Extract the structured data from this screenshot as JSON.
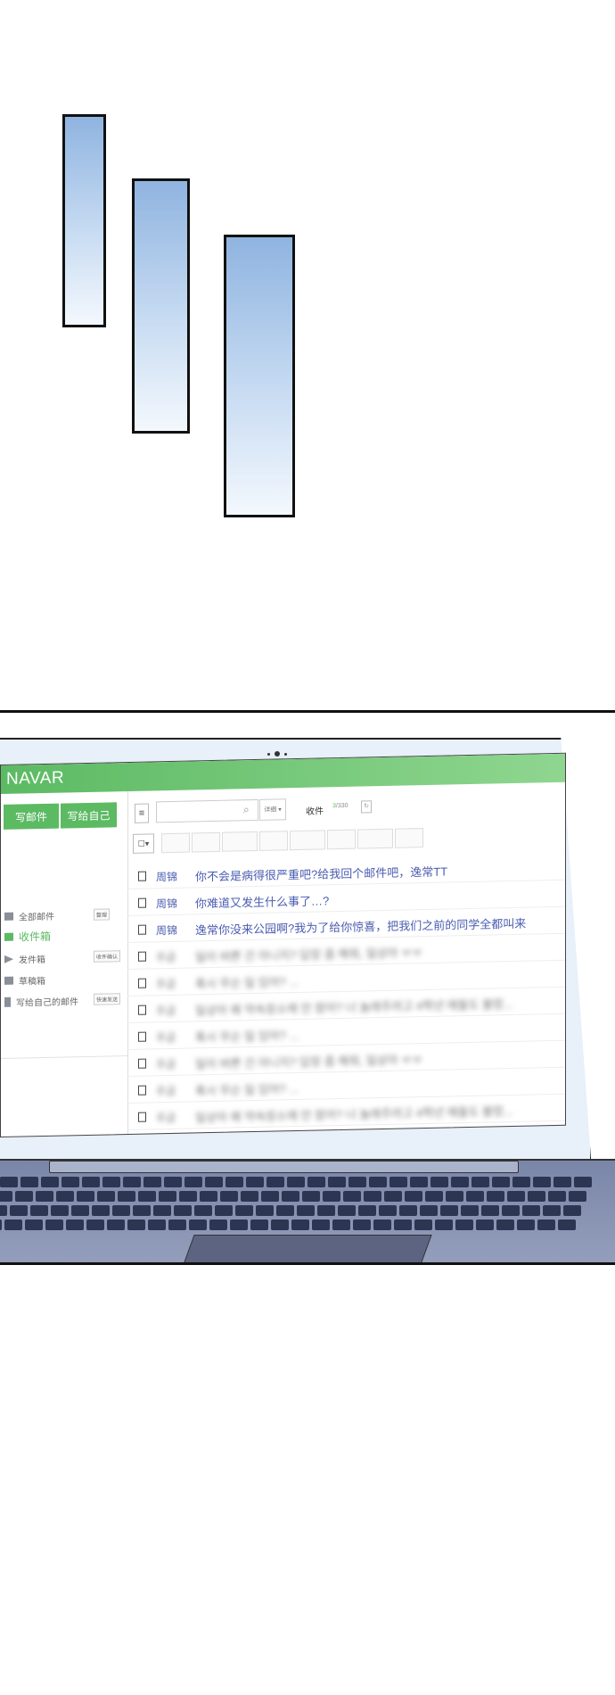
{
  "app": {
    "logo": "NAVAR"
  },
  "sidebar": {
    "compose_label": "写邮件",
    "write_self_label": "写给自己",
    "items": [
      {
        "label": "全部邮件",
        "tag": "整理",
        "icon": "mail-icon"
      },
      {
        "label": "收件箱",
        "tag": "",
        "icon": "inbox-icon"
      },
      {
        "label": "发件箱",
        "tag": "收件确认",
        "icon": "send-icon"
      },
      {
        "label": "草稿箱",
        "tag": "",
        "icon": "folder-icon"
      },
      {
        "label": "写给自己的邮件",
        "tag": "快速发送",
        "icon": "note-icon"
      }
    ]
  },
  "toolbar": {
    "detail_label": "详细 ▾",
    "inbox_label": "收件",
    "unread_count": "3",
    "total_count": "/330"
  },
  "mail_list": [
    {
      "sender": "周锦",
      "subject": "你不会是病得很严重吧?给我回个邮件吧，逸常TT"
    },
    {
      "sender": "周锦",
      "subject": "你难道又发生什么事了…?"
    },
    {
      "sender": "周锦",
      "subject": "逸常你没来公园啊?我为了给你惊喜，把我们之前的同学全都叫来"
    },
    {
      "sender": "주급",
      "subject": "일이 바쁜 건 아니지? 답장 좀 해줘, 일상아 ㅠㅠ"
    },
    {
      "sender": "주급",
      "subject": "혹시 무슨 일 있어? ..."
    },
    {
      "sender": "주급",
      "subject": "일상아 왜 약속장소에 안 왔어? 너 놀래주려고 4학년 애들도 불렀..."
    },
    {
      "sender": "주급",
      "subject": "혹시 무슨 일 있어? ..."
    },
    {
      "sender": "주급",
      "subject": "일이 바쁜 건 아니지? 답장 좀 해줘, 일상아 ㅠㅠ"
    },
    {
      "sender": "주급",
      "subject": "혹시 무슨 일 있어? ..."
    },
    {
      "sender": "주급",
      "subject": "일상아 왜 약속장소에 안 왔어? 너 놀래주려고 4학년 애들도 불렀..."
    }
  ]
}
